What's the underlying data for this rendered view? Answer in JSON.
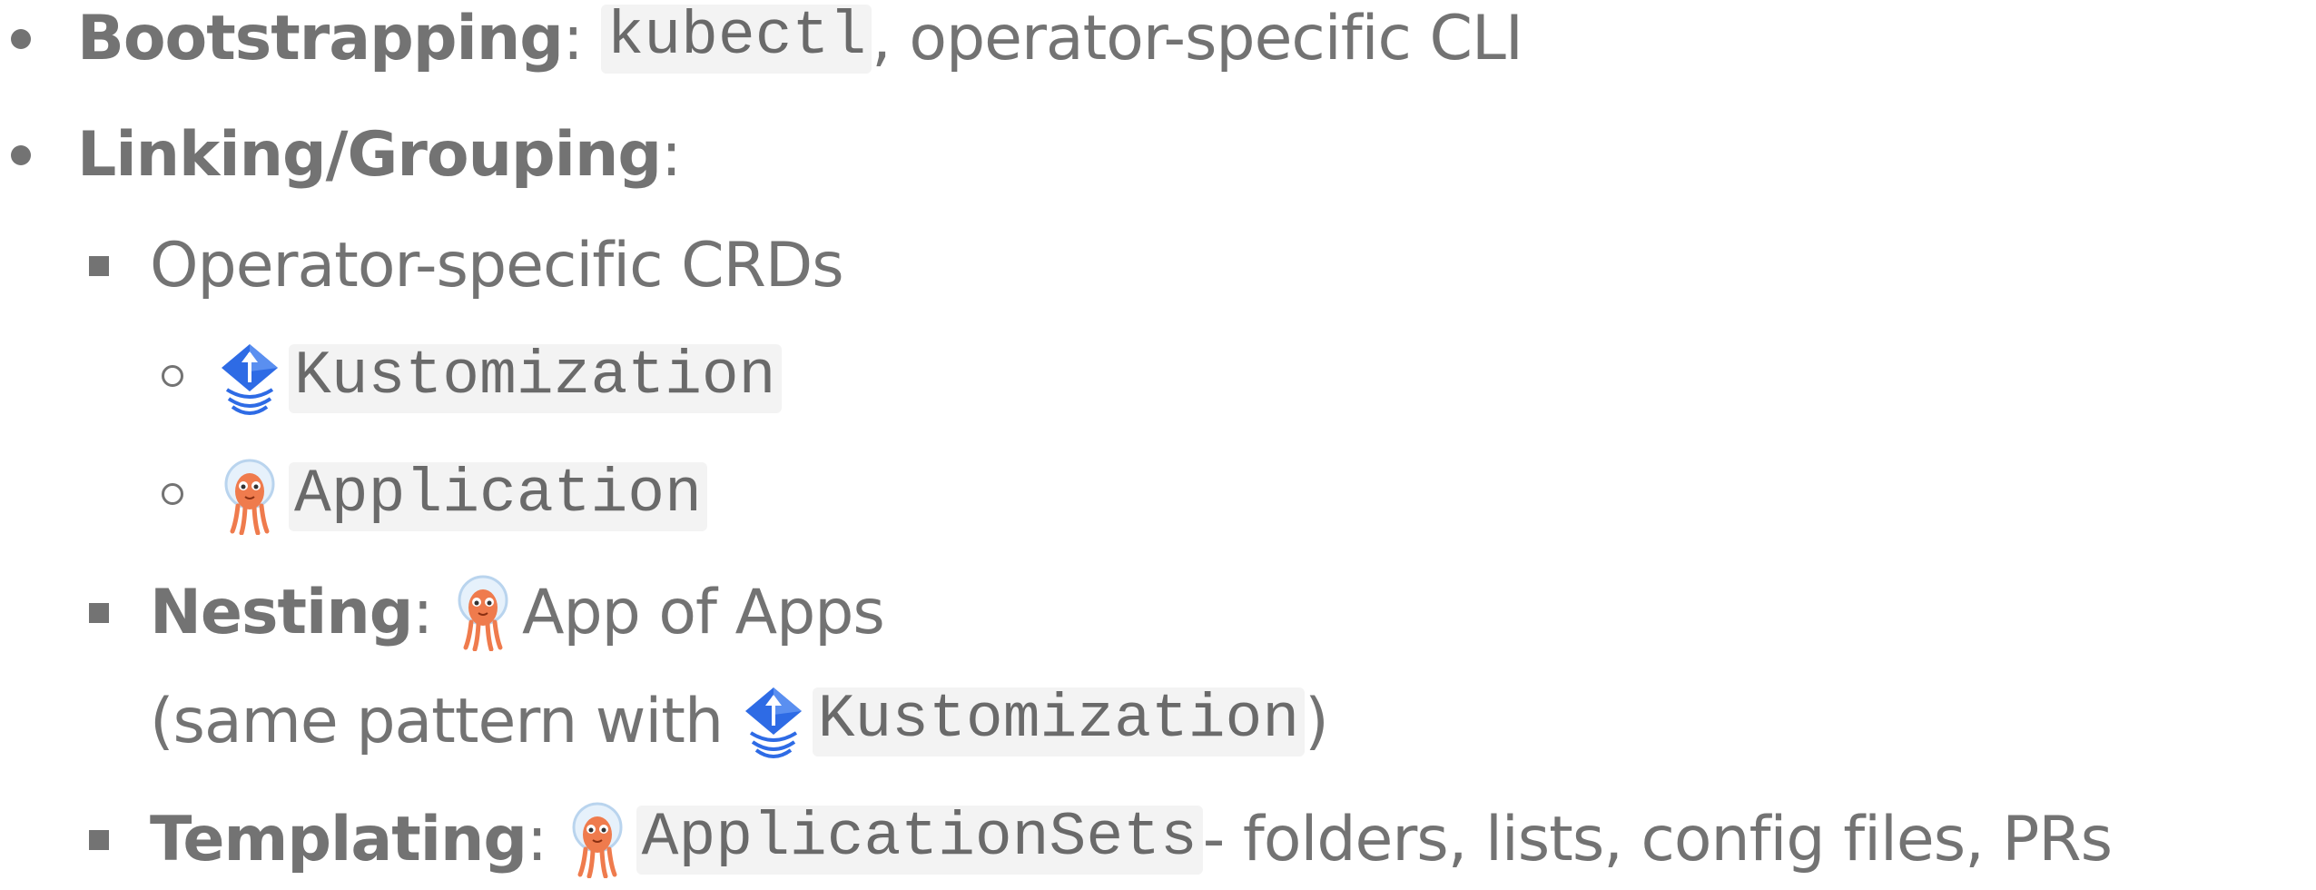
{
  "items": {
    "bootstrapping": {
      "label": "Bootstrapping",
      "sep": ":",
      "code": "kubectl",
      "rest": ", operator-specific CLI"
    },
    "linking": {
      "label": "Linking/Grouping",
      "sep": ":"
    },
    "operator_crds": {
      "text": "Operator-specific CRDs"
    },
    "kustomization": {
      "icon": "flux-icon",
      "code": "Kustomization"
    },
    "application": {
      "icon": "argo-octopus-icon",
      "code": "Application"
    },
    "nesting": {
      "label": "Nesting",
      "sep": ":",
      "icon": "argo-octopus-icon",
      "text": "App of Apps",
      "continuation_open": "(same pattern with",
      "continuation_icon": "flux-icon",
      "continuation_code": "Kustomization",
      "continuation_close": ")"
    },
    "templating": {
      "label": "Templating",
      "sep": ":",
      "icon": "argo-octopus-icon",
      "code": "ApplicationSets",
      "rest": " - folders, lists, config files, PRs"
    }
  },
  "colors": {
    "text": "#737373",
    "code_bg": "#f3f3f3",
    "flux_blue": "#2e6be5",
    "argo_orange": "#ef7b4d"
  }
}
